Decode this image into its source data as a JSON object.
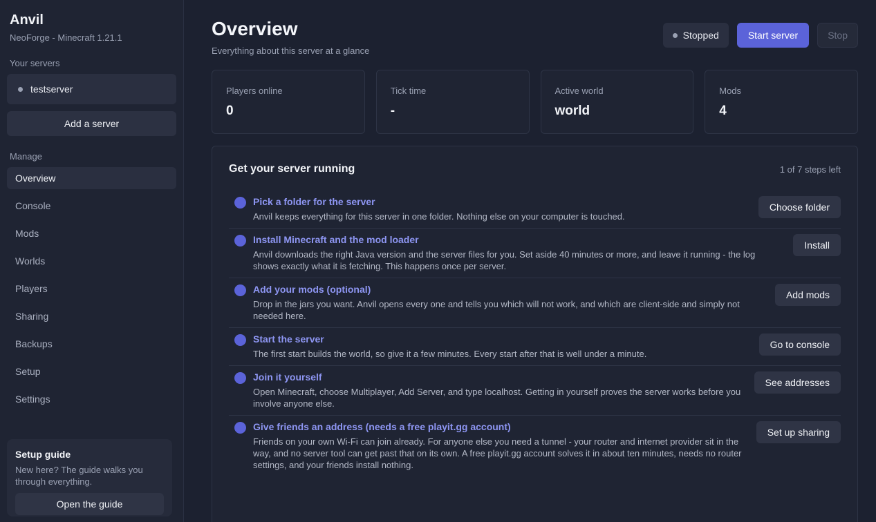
{
  "sidebar": {
    "app_name": "Anvil",
    "app_subtitle": "NeoForge - Minecraft 1.21.1",
    "servers_label": "Your servers",
    "servers": [
      {
        "name": "testserver"
      }
    ],
    "add_server_label": "Add a server",
    "manage_label": "Manage",
    "nav": [
      {
        "label": "Overview",
        "active": true
      },
      {
        "label": "Console"
      },
      {
        "label": "Mods"
      },
      {
        "label": "Worlds"
      },
      {
        "label": "Players"
      },
      {
        "label": "Sharing"
      },
      {
        "label": "Backups"
      },
      {
        "label": "Setup"
      },
      {
        "label": "Settings"
      }
    ],
    "guide": {
      "title": "Setup guide",
      "text": "New here? The guide walks you through everything.",
      "button": "Open the guide"
    }
  },
  "header": {
    "title": "Overview",
    "subtitle": "Everything about this server at a glance",
    "status": "Stopped",
    "start_label": "Start server",
    "stop_label": "Stop"
  },
  "stats": [
    {
      "label": "Players online",
      "value": "0"
    },
    {
      "label": "Tick time",
      "value": "-"
    },
    {
      "label": "Active world",
      "value": "world"
    },
    {
      "label": "Mods",
      "value": "4"
    }
  ],
  "steps": {
    "title": "Get your server running",
    "count": "1 of 7 steps left",
    "items": [
      {
        "title": "Pick a folder for the server",
        "desc": "Anvil keeps everything for this server in one folder. Nothing else on your computer is touched.",
        "button": "Choose folder"
      },
      {
        "title": "Install Minecraft and the mod loader",
        "desc": "Anvil downloads the right Java version and the server files for you. Set aside 40 minutes or more, and leave it running - the log shows exactly what it is fetching. This happens once per server.",
        "button": "Install"
      },
      {
        "title": "Add your mods (optional)",
        "desc": "Drop in the jars you want. Anvil opens every one and tells you which will not work, and which are client-side and simply not needed here.",
        "button": "Add mods"
      },
      {
        "title": "Start the server",
        "desc": "The first start builds the world, so give it a few minutes. Every start after that is well under a minute.",
        "button": "Go to console"
      },
      {
        "title": "Join it yourself",
        "desc": "Open Minecraft, choose Multiplayer, Add Server, and type localhost. Getting in yourself proves the server works before you involve anyone else.",
        "button": "See addresses"
      },
      {
        "title": "Give friends an address (needs a free playit.gg account)",
        "desc": "Friends on your own Wi-Fi can join already. For anyone else you need a tunnel - your router and internet provider sit in the way, and no server tool can get past that on its own. A free playit.gg account solves it in about ten minutes, needs no router settings, and your friends install nothing.",
        "button": "Set up sharing"
      }
    ]
  },
  "colors": {
    "accent": "#5b63d9",
    "accent_text": "#8e96f3",
    "background": "#1c2130"
  }
}
